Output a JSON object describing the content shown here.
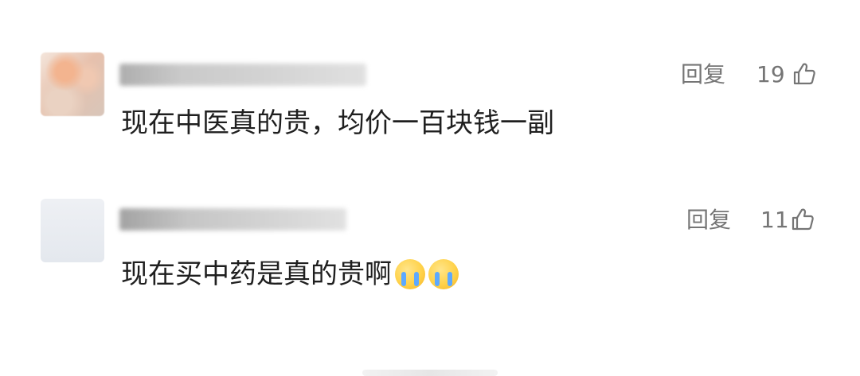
{
  "comments": [
    {
      "text": "现在中医真的贵，均价一百块钱一副",
      "reply_label": "回复",
      "likes": "19"
    },
    {
      "text": "现在买中药是真的贵啊",
      "reply_label": "回复",
      "likes": "11",
      "emojis": [
        "loudly-crying-face",
        "loudly-crying-face"
      ]
    }
  ],
  "icons": {
    "like": "thumbs-up-icon"
  },
  "colors": {
    "text_primary": "#1f1f1f",
    "text_secondary": "#757575",
    "background": "#ffffff"
  }
}
